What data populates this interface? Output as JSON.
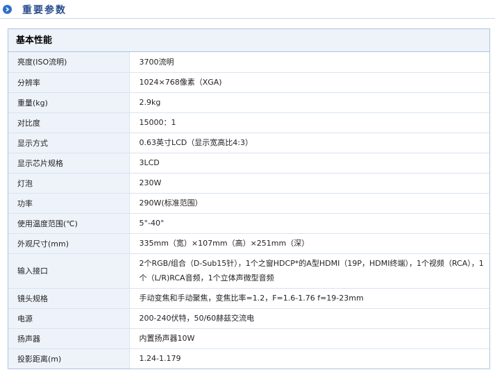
{
  "section": {
    "title": "重要参数",
    "bullet_icon": "arrow-right-circle-icon"
  },
  "panel": {
    "title": "基本性能"
  },
  "specs": [
    {
      "label": "亮度(ISO流明)",
      "value": "3700流明"
    },
    {
      "label": "分辨率",
      "value": "1024×768像素（XGA)"
    },
    {
      "label": "重量(kg)",
      "value": "2.9kg"
    },
    {
      "label": "对比度",
      "value": "15000：1"
    },
    {
      "label": "显示方式",
      "value": "0.63英寸LCD（显示宽高比4:3）"
    },
    {
      "label": "显示芯片规格",
      "value": "3LCD"
    },
    {
      "label": "灯泡",
      "value": "230W"
    },
    {
      "label": "功率",
      "value": "290W(标准范围）"
    },
    {
      "label": "使用温度范围(℃)",
      "value": "5°-40°"
    },
    {
      "label": "外观尺寸(mm)",
      "value": "335mm（宽）×107mm（高）×251mm（深）"
    },
    {
      "label": "输入接口",
      "value": "2个RGB/组合（D-Sub15针），1个之窗HDCP*的A型HDMI（19P，HDMI终端），1个视频（RCA），1个（L/R)RCA音频，1个立体声微型音频"
    },
    {
      "label": "镜头规格",
      "value": "手动变焦和手动聚焦，变焦比率=1.2，F=1.6-1.76 f=19-23mm"
    },
    {
      "label": "电源",
      "value": "200-240伏特，50/60赫兹交流电"
    },
    {
      "label": "扬声器",
      "value": "内置扬声器10W"
    },
    {
      "label": "投影距离(m)",
      "value": "1.24-1.179"
    }
  ],
  "colors": {
    "accent": "#2f6fc9",
    "header_text": "#2b4e8c",
    "label_bg": "#eef3fa",
    "border": "#aec3e0",
    "label_text": "#1b3f80"
  }
}
